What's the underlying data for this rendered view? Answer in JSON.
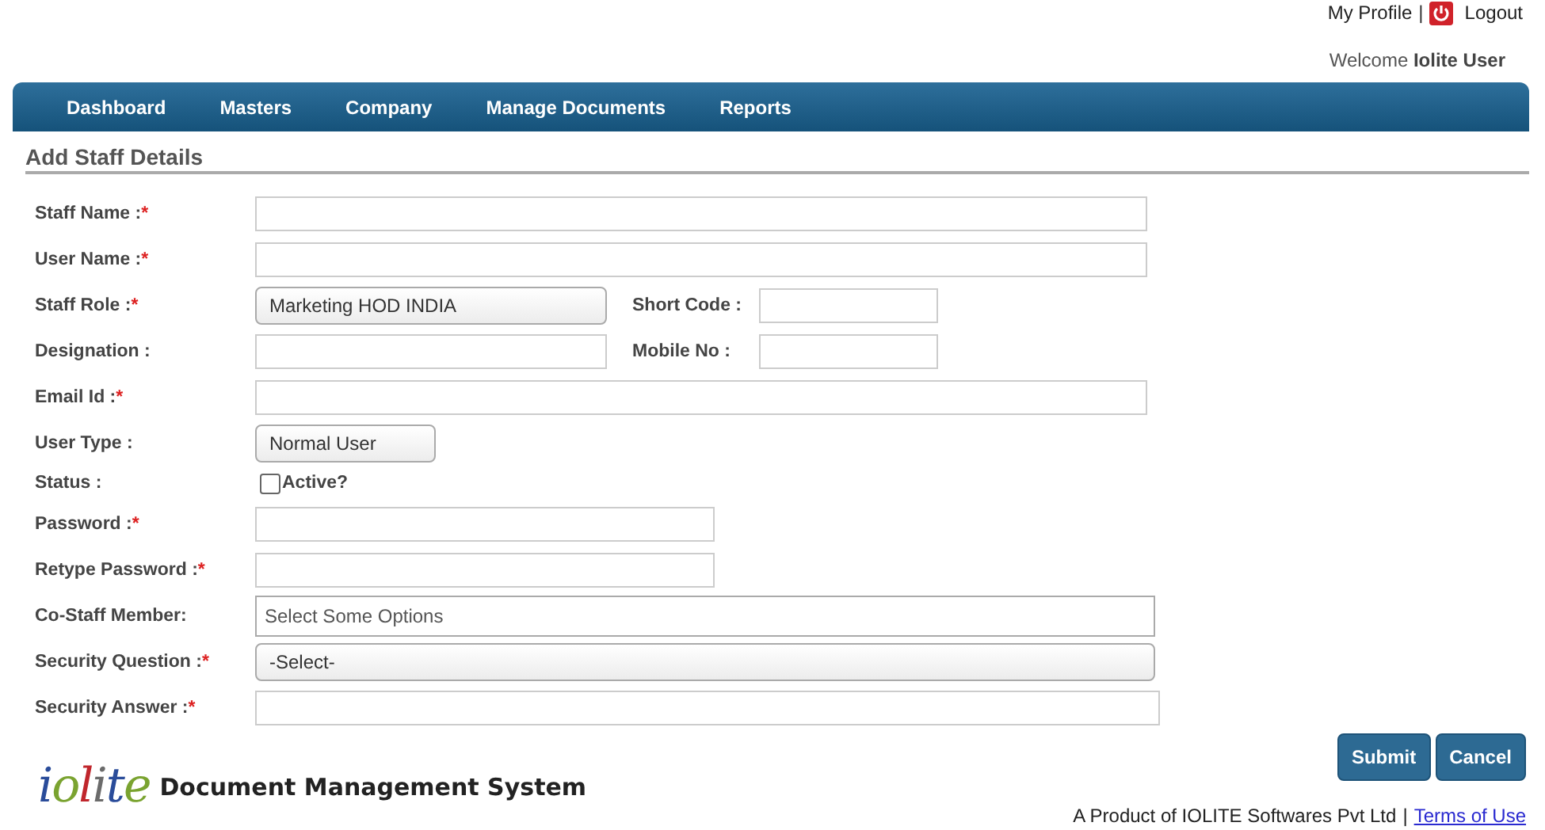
{
  "header": {
    "profile_link": "My Profile",
    "separator": "|",
    "logout_link": "Logout",
    "welcome": "Welcome",
    "user": "Iolite User"
  },
  "nav": [
    {
      "label": "Dashboard"
    },
    {
      "label": "Masters"
    },
    {
      "label": "Company"
    },
    {
      "label": "Manage Documents"
    },
    {
      "label": "Reports"
    }
  ],
  "page_title": "Add Staff Details",
  "fields": [
    {
      "label": "Staff Name :",
      "mark": "*",
      "kind": "text"
    },
    {
      "label": "User Name :",
      "mark": "*",
      "kind": "text"
    },
    {
      "label": "Staff Role :",
      "mark": "*",
      "kind": "select",
      "value": "Marketing HOD INDIA",
      "side": {
        "label": "Short Code :"
      }
    },
    {
      "label": "Designation :",
      "kind": "text",
      "side": {
        "label": "Mobile No :"
      }
    },
    {
      "label": "Email Id :",
      "mark": "*",
      "kind": "text"
    },
    {
      "label": "User Type :",
      "kind": "select",
      "value": "Normal User"
    },
    {
      "label": "Status :",
      "kind": "checkbox",
      "option": "Active?",
      "checked": false
    },
    {
      "label": "Password :",
      "mark": "*",
      "kind": "password"
    },
    {
      "label": "Retype Password :",
      "mark": "*",
      "kind": "password"
    },
    {
      "label": "Co-Staff Member:",
      "kind": "multiselect",
      "placeholder": "Select Some Options"
    },
    {
      "label": "Security Question :",
      "mark": "*",
      "kind": "select",
      "value": "-Select-"
    },
    {
      "label": "Security Answer :",
      "mark": "*",
      "kind": "text"
    }
  ],
  "buttons": [
    {
      "label": "Submit"
    },
    {
      "label": "Cancel"
    }
  ],
  "logo": {
    "letters": "iolite",
    "title": "Document Management System"
  },
  "footer": {
    "text": "A Product of IOLITE Softwares Pvt Ltd",
    "separator": "|",
    "link": "Terms of Use"
  }
}
